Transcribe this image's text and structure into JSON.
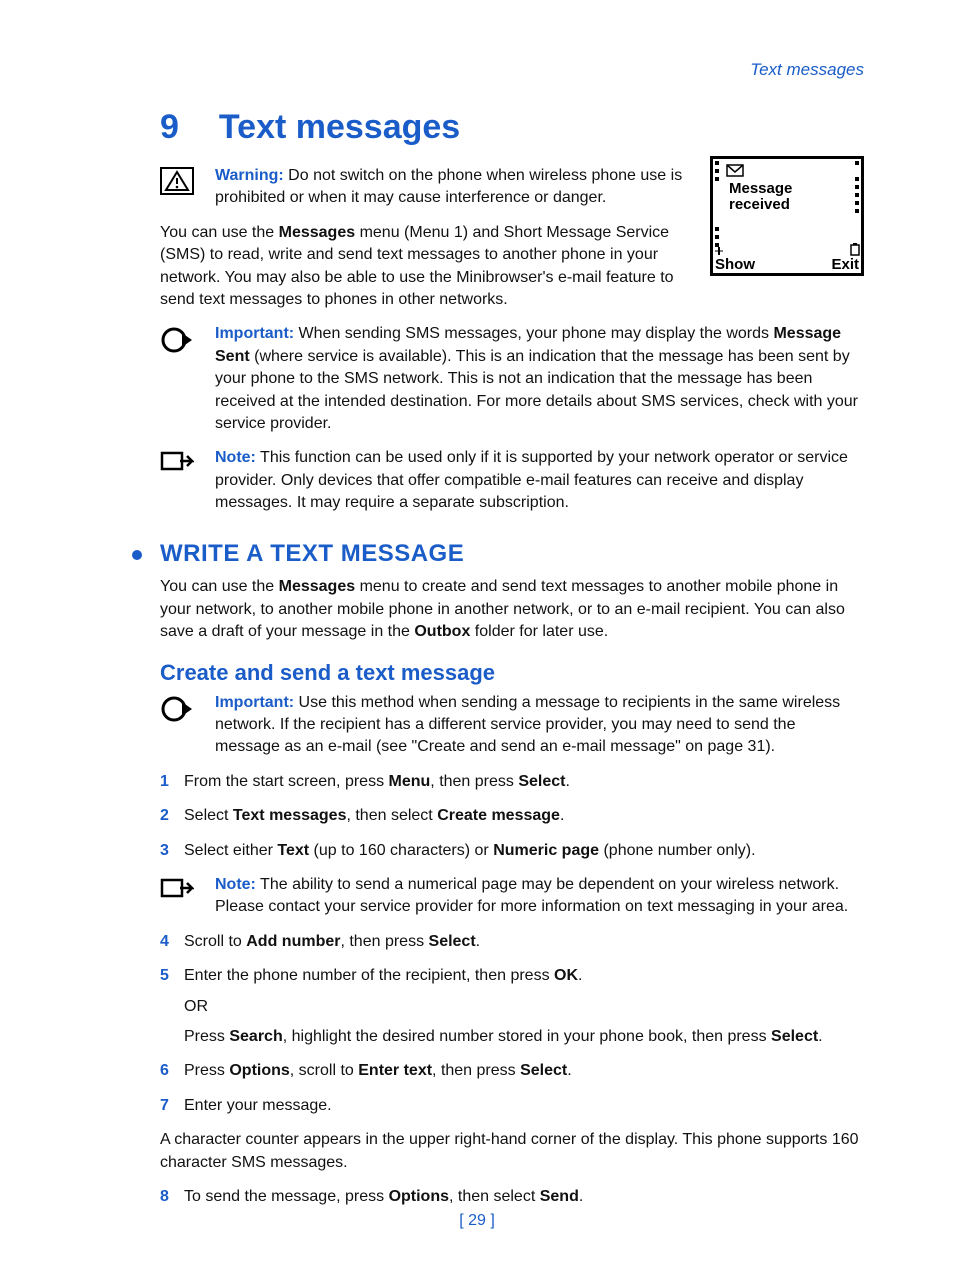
{
  "runningHead": "Text messages",
  "chapter": {
    "number": "9",
    "title": "Text messages"
  },
  "warning": {
    "label": "Warning:",
    "text": " Do not switch on the phone when wireless phone use is prohibited or when it may cause interference or danger."
  },
  "intro": {
    "pre": "You can use the ",
    "b1": "Messages",
    "post": " menu (Menu 1) and Short Message Service (SMS) to read, write and send text messages to another phone in your network. You may also be able to use the Minibrowser's e-mail feature to send text messages to phones in other networks."
  },
  "phoneScreen": {
    "line1": "Message",
    "line2": "received",
    "left": "Show",
    "right": "Exit"
  },
  "important1": {
    "label": "Important:",
    "a": " When sending SMS messages, your phone may display the words ",
    "b": "Message Sent",
    "c": " (where service is available). This is an indication that the message has been sent by your phone to the SMS network. This is not an indication that the message has been received at the intended destination. For more details about SMS services, check with your service provider."
  },
  "note1": {
    "label": "Note:",
    "text": " This function can be used only if it is supported by your network operator or service provider. Only devices that offer compatible e-mail features can receive and display messages. It may require a separate subscription."
  },
  "sectionTitle": "WRITE A TEXT MESSAGE",
  "sectionIntro": {
    "a": "You can use the ",
    "b": "Messages",
    "c": " menu to create and send text messages to another mobile phone in your network, to another mobile phone in another network, or to an e-mail recipient. You can also save a draft of your message in the ",
    "d": "Outbox",
    "e": " folder for later use."
  },
  "subhead": "Create and send a text message",
  "important2": {
    "label": "Important:",
    "text": " Use this method when sending a message to recipients in the same wireless network. If the recipient has a different service provider, you may need to send the message as an e-mail (see \"Create and send an e-mail message\" on page 31)."
  },
  "steps": [
    {
      "n": "1",
      "parts": [
        "From the start screen, press ",
        "Menu",
        ", then press ",
        "Select",
        "."
      ]
    },
    {
      "n": "2",
      "parts": [
        "Select ",
        "Text messages",
        ", then select ",
        "Create message",
        "."
      ]
    },
    {
      "n": "3",
      "parts": [
        "Select either ",
        "Text",
        " (up to 160 characters) or ",
        "Numeric page",
        " (phone number only)."
      ]
    }
  ],
  "note2": {
    "label": "Note:",
    "text": " The ability to send a numerical page may be dependent on your wireless network. Please contact your service provider for more information on text messaging in your area."
  },
  "steps2": [
    {
      "n": "4",
      "parts": [
        "Scroll to ",
        "Add number",
        ", then press ",
        "Select",
        "."
      ]
    },
    {
      "n": "5",
      "parts": [
        "Enter the phone number of the recipient, then press ",
        "OK",
        "."
      ],
      "or": "OR",
      "alt": [
        "Press ",
        "Search",
        ", highlight the desired number stored in your phone book, then press ",
        "Select",
        "."
      ]
    },
    {
      "n": "6",
      "parts": [
        "Press ",
        "Options",
        ", scroll to ",
        "Enter text",
        ", then press ",
        "Select",
        "."
      ]
    },
    {
      "n": "7",
      "parts": [
        "Enter your message."
      ]
    }
  ],
  "counterPara": "A character counter appears in the upper right-hand corner of the display. This phone supports 160 character SMS messages.",
  "step8": {
    "n": "8",
    "parts": [
      "To send the message, press ",
      "Options",
      ", then select ",
      "Send",
      "."
    ]
  },
  "pageNumber": "[ 29 ]"
}
